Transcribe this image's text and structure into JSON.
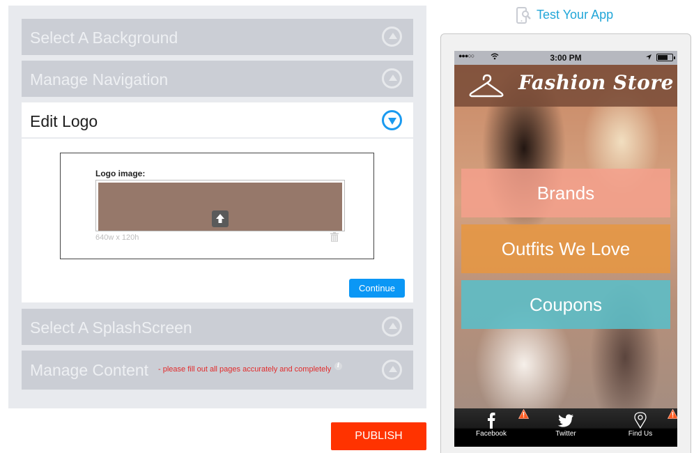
{
  "editor": {
    "sections": [
      {
        "title": "Select A Background",
        "state": "collapsed"
      },
      {
        "title": "Manage Navigation",
        "state": "collapsed"
      },
      {
        "title": "Edit Logo",
        "state": "expanded"
      },
      {
        "title": "Select A SplashScreen",
        "state": "collapsed"
      },
      {
        "title": "Manage Content",
        "state": "collapsed",
        "warning": "- please fill out all pages accurately and completely",
        "info_icon": "i"
      }
    ],
    "logo": {
      "label": "Logo image:",
      "size_hint": "640w x 120h",
      "fill_color": "#96786a"
    },
    "continue_label": "Continue",
    "publish_label": "PUBLISH"
  },
  "preview": {
    "test_label": "Test Your App",
    "status_bar": {
      "signal": "●●●○○",
      "time": "3:00 PM"
    },
    "store_title": "Fashion Store",
    "menu": [
      {
        "label": "Brands",
        "color": "#f4a08c"
      },
      {
        "label": "Outfits We Love",
        "color": "#e69641"
      },
      {
        "label": "Coupons",
        "color": "#5abec8"
      }
    ],
    "tabs": [
      {
        "label": "Facebook",
        "icon": "facebook-icon",
        "alert": true
      },
      {
        "label": "Twitter",
        "icon": "twitter-icon",
        "alert": false
      },
      {
        "label": "Find Us",
        "icon": "map-pin-icon",
        "alert": true
      }
    ]
  },
  "colors": {
    "accent_blue": "#0b97f5",
    "publish_red": "#ff3300",
    "test_link": "#21a6d8",
    "warning_red": "#e12b2b"
  }
}
